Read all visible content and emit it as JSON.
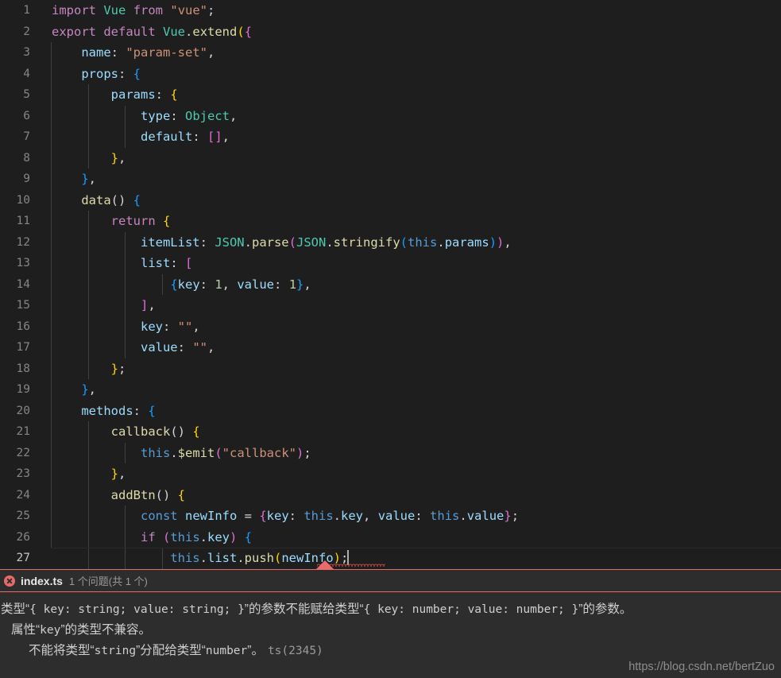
{
  "editor": {
    "language": "typescript",
    "active_line": 27,
    "theme_background": "#1e1e1e",
    "lines": [
      {
        "n": "1",
        "tokens": [
          {
            "t": "import",
            "c": "t-kw"
          },
          {
            "t": " ",
            "c": "t-punct"
          },
          {
            "t": "Vue",
            "c": "t-type"
          },
          {
            "t": " ",
            "c": "t-punct"
          },
          {
            "t": "from",
            "c": "t-kw"
          },
          {
            "t": " ",
            "c": "t-punct"
          },
          {
            "t": "\"vue\"",
            "c": "t-str"
          },
          {
            "t": ";",
            "c": "t-punct"
          }
        ]
      },
      {
        "n": "2",
        "tokens": [
          {
            "t": "export",
            "c": "t-kw"
          },
          {
            "t": " ",
            "c": "t-punct"
          },
          {
            "t": "default",
            "c": "t-kw"
          },
          {
            "t": " ",
            "c": "t-punct"
          },
          {
            "t": "Vue",
            "c": "t-type"
          },
          {
            "t": ".",
            "c": "t-punct"
          },
          {
            "t": "extend",
            "c": "t-fn"
          },
          {
            "t": "(",
            "c": "t-p1"
          },
          {
            "t": "{",
            "c": "t-p2"
          }
        ]
      },
      {
        "n": "3",
        "tokens": [
          {
            "t": "    ",
            "c": "t-punct"
          },
          {
            "t": "name",
            "c": "t-prop"
          },
          {
            "t": ": ",
            "c": "t-punct"
          },
          {
            "t": "\"param-set\"",
            "c": "t-str"
          },
          {
            "t": ",",
            "c": "t-punct"
          }
        ]
      },
      {
        "n": "4",
        "tokens": [
          {
            "t": "    ",
            "c": "t-punct"
          },
          {
            "t": "props",
            "c": "t-prop"
          },
          {
            "t": ": ",
            "c": "t-punct"
          },
          {
            "t": "{",
            "c": "t-p3"
          }
        ]
      },
      {
        "n": "5",
        "tokens": [
          {
            "t": "        ",
            "c": "t-punct"
          },
          {
            "t": "params",
            "c": "t-prop"
          },
          {
            "t": ": ",
            "c": "t-punct"
          },
          {
            "t": "{",
            "c": "t-p1"
          }
        ]
      },
      {
        "n": "6",
        "tokens": [
          {
            "t": "            ",
            "c": "t-punct"
          },
          {
            "t": "type",
            "c": "t-prop"
          },
          {
            "t": ": ",
            "c": "t-punct"
          },
          {
            "t": "Object",
            "c": "t-type"
          },
          {
            "t": ",",
            "c": "t-punct"
          }
        ]
      },
      {
        "n": "7",
        "tokens": [
          {
            "t": "            ",
            "c": "t-punct"
          },
          {
            "t": "default",
            "c": "t-prop"
          },
          {
            "t": ": ",
            "c": "t-punct"
          },
          {
            "t": "[]",
            "c": "t-p2"
          },
          {
            "t": ",",
            "c": "t-punct"
          }
        ]
      },
      {
        "n": "8",
        "tokens": [
          {
            "t": "        ",
            "c": "t-punct"
          },
          {
            "t": "}",
            "c": "t-p1"
          },
          {
            "t": ",",
            "c": "t-punct"
          }
        ]
      },
      {
        "n": "9",
        "tokens": [
          {
            "t": "    ",
            "c": "t-punct"
          },
          {
            "t": "}",
            "c": "t-p3"
          },
          {
            "t": ",",
            "c": "t-punct"
          }
        ]
      },
      {
        "n": "10",
        "tokens": [
          {
            "t": "    ",
            "c": "t-punct"
          },
          {
            "t": "data",
            "c": "t-fn"
          },
          {
            "t": "() ",
            "c": "t-punct"
          },
          {
            "t": "{",
            "c": "t-p3"
          }
        ]
      },
      {
        "n": "11",
        "tokens": [
          {
            "t": "        ",
            "c": "t-punct"
          },
          {
            "t": "return",
            "c": "t-kw"
          },
          {
            "t": " ",
            "c": "t-punct"
          },
          {
            "t": "{",
            "c": "t-p1"
          }
        ]
      },
      {
        "n": "12",
        "tokens": [
          {
            "t": "            ",
            "c": "t-punct"
          },
          {
            "t": "itemList",
            "c": "t-prop"
          },
          {
            "t": ": ",
            "c": "t-punct"
          },
          {
            "t": "JSON",
            "c": "t-type"
          },
          {
            "t": ".",
            "c": "t-punct"
          },
          {
            "t": "parse",
            "c": "t-fn"
          },
          {
            "t": "(",
            "c": "t-p2"
          },
          {
            "t": "JSON",
            "c": "t-type"
          },
          {
            "t": ".",
            "c": "t-punct"
          },
          {
            "t": "stringify",
            "c": "t-fn"
          },
          {
            "t": "(",
            "c": "t-p3"
          },
          {
            "t": "this",
            "c": "t-this"
          },
          {
            "t": ".",
            "c": "t-punct"
          },
          {
            "t": "params",
            "c": "t-prop"
          },
          {
            "t": ")",
            "c": "t-p3"
          },
          {
            "t": ")",
            "c": "t-p2"
          },
          {
            "t": ",",
            "c": "t-punct"
          }
        ]
      },
      {
        "n": "13",
        "tokens": [
          {
            "t": "            ",
            "c": "t-punct"
          },
          {
            "t": "list",
            "c": "t-prop"
          },
          {
            "t": ": ",
            "c": "t-punct"
          },
          {
            "t": "[",
            "c": "t-p2"
          }
        ]
      },
      {
        "n": "14",
        "tokens": [
          {
            "t": "                ",
            "c": "t-punct"
          },
          {
            "t": "{",
            "c": "t-p3"
          },
          {
            "t": "key",
            "c": "t-prop"
          },
          {
            "t": ": ",
            "c": "t-punct"
          },
          {
            "t": "1",
            "c": "t-num"
          },
          {
            "t": ", ",
            "c": "t-punct"
          },
          {
            "t": "value",
            "c": "t-prop"
          },
          {
            "t": ": ",
            "c": "t-punct"
          },
          {
            "t": "1",
            "c": "t-num"
          },
          {
            "t": "}",
            "c": "t-p3"
          },
          {
            "t": ",",
            "c": "t-punct"
          }
        ]
      },
      {
        "n": "15",
        "tokens": [
          {
            "t": "            ",
            "c": "t-punct"
          },
          {
            "t": "]",
            "c": "t-p2"
          },
          {
            "t": ",",
            "c": "t-punct"
          }
        ]
      },
      {
        "n": "16",
        "tokens": [
          {
            "t": "            ",
            "c": "t-punct"
          },
          {
            "t": "key",
            "c": "t-prop"
          },
          {
            "t": ": ",
            "c": "t-punct"
          },
          {
            "t": "\"\"",
            "c": "t-str"
          },
          {
            "t": ",",
            "c": "t-punct"
          }
        ]
      },
      {
        "n": "17",
        "tokens": [
          {
            "t": "            ",
            "c": "t-punct"
          },
          {
            "t": "value",
            "c": "t-prop"
          },
          {
            "t": ": ",
            "c": "t-punct"
          },
          {
            "t": "\"\"",
            "c": "t-str"
          },
          {
            "t": ",",
            "c": "t-punct"
          }
        ]
      },
      {
        "n": "18",
        "tokens": [
          {
            "t": "        ",
            "c": "t-punct"
          },
          {
            "t": "}",
            "c": "t-p1"
          },
          {
            "t": ";",
            "c": "t-punct"
          }
        ]
      },
      {
        "n": "19",
        "tokens": [
          {
            "t": "    ",
            "c": "t-punct"
          },
          {
            "t": "}",
            "c": "t-p3"
          },
          {
            "t": ",",
            "c": "t-punct"
          }
        ]
      },
      {
        "n": "20",
        "tokens": [
          {
            "t": "    ",
            "c": "t-punct"
          },
          {
            "t": "methods",
            "c": "t-prop"
          },
          {
            "t": ": ",
            "c": "t-punct"
          },
          {
            "t": "{",
            "c": "t-p3"
          }
        ]
      },
      {
        "n": "21",
        "tokens": [
          {
            "t": "        ",
            "c": "t-punct"
          },
          {
            "t": "callback",
            "c": "t-fn"
          },
          {
            "t": "() ",
            "c": "t-punct"
          },
          {
            "t": "{",
            "c": "t-p1"
          }
        ]
      },
      {
        "n": "22",
        "tokens": [
          {
            "t": "            ",
            "c": "t-punct"
          },
          {
            "t": "this",
            "c": "t-this"
          },
          {
            "t": ".",
            "c": "t-punct"
          },
          {
            "t": "$emit",
            "c": "t-fn"
          },
          {
            "t": "(",
            "c": "t-p2"
          },
          {
            "t": "\"callback\"",
            "c": "t-str"
          },
          {
            "t": ")",
            "c": "t-p2"
          },
          {
            "t": ";",
            "c": "t-punct"
          }
        ]
      },
      {
        "n": "23",
        "tokens": [
          {
            "t": "        ",
            "c": "t-punct"
          },
          {
            "t": "}",
            "c": "t-p1"
          },
          {
            "t": ",",
            "c": "t-punct"
          }
        ]
      },
      {
        "n": "24",
        "tokens": [
          {
            "t": "        ",
            "c": "t-punct"
          },
          {
            "t": "addBtn",
            "c": "t-fn"
          },
          {
            "t": "() ",
            "c": "t-punct"
          },
          {
            "t": "{",
            "c": "t-p1"
          }
        ]
      },
      {
        "n": "25",
        "tokens": [
          {
            "t": "            ",
            "c": "t-punct"
          },
          {
            "t": "const",
            "c": "t-const"
          },
          {
            "t": " ",
            "c": "t-punct"
          },
          {
            "t": "newInfo",
            "c": "t-var"
          },
          {
            "t": " = ",
            "c": "t-punct"
          },
          {
            "t": "{",
            "c": "t-p2"
          },
          {
            "t": "key",
            "c": "t-prop"
          },
          {
            "t": ": ",
            "c": "t-punct"
          },
          {
            "t": "this",
            "c": "t-this"
          },
          {
            "t": ".",
            "c": "t-punct"
          },
          {
            "t": "key",
            "c": "t-prop"
          },
          {
            "t": ", ",
            "c": "t-punct"
          },
          {
            "t": "value",
            "c": "t-prop"
          },
          {
            "t": ": ",
            "c": "t-punct"
          },
          {
            "t": "this",
            "c": "t-this"
          },
          {
            "t": ".",
            "c": "t-punct"
          },
          {
            "t": "value",
            "c": "t-prop"
          },
          {
            "t": "}",
            "c": "t-p2"
          },
          {
            "t": ";",
            "c": "t-punct"
          }
        ]
      },
      {
        "n": "26",
        "tokens": [
          {
            "t": "            ",
            "c": "t-punct"
          },
          {
            "t": "if",
            "c": "t-kw"
          },
          {
            "t": " ",
            "c": "t-punct"
          },
          {
            "t": "(",
            "c": "t-p2"
          },
          {
            "t": "this",
            "c": "t-this"
          },
          {
            "t": ".",
            "c": "t-punct"
          },
          {
            "t": "key",
            "c": "t-prop"
          },
          {
            "t": ")",
            "c": "t-p2"
          },
          {
            "t": " ",
            "c": "t-punct"
          },
          {
            "t": "{",
            "c": "t-p3"
          }
        ]
      },
      {
        "n": "27",
        "tokens": [
          {
            "t": "                ",
            "c": "t-punct"
          },
          {
            "t": "this",
            "c": "t-this"
          },
          {
            "t": ".",
            "c": "t-punct"
          },
          {
            "t": "list",
            "c": "t-prop"
          },
          {
            "t": ".",
            "c": "t-punct"
          },
          {
            "t": "push",
            "c": "t-fn"
          },
          {
            "t": "(",
            "c": "t-p1"
          },
          {
            "t": "newInfo",
            "c": "t-var"
          },
          {
            "t": ")",
            "c": "t-p1"
          },
          {
            "t": ";",
            "c": "t-punct"
          }
        ]
      }
    ]
  },
  "problem_panel": {
    "error_icon": "error-circle-x-icon",
    "file_name": "index.ts",
    "problem_count": "1 个问题(共 1 个)",
    "accent_color": "#e96a6a",
    "message_lines": [
      {
        "level": 1,
        "parts": [
          {
            "t": "类型“",
            "mono": false
          },
          {
            "t": "{ key: string; value: string; }",
            "mono": true
          },
          {
            "t": "”的参数不能赋给类型“",
            "mono": false
          },
          {
            "t": "{ key: number; value: number; }",
            "mono": true
          },
          {
            "t": "”的参数。",
            "mono": false
          }
        ]
      },
      {
        "level": 2,
        "parts": [
          {
            "t": "属性“",
            "mono": false
          },
          {
            "t": "key",
            "mono": true
          },
          {
            "t": "”的类型不兼容。",
            "mono": false
          }
        ]
      },
      {
        "level": 3,
        "parts": [
          {
            "t": "不能将类型“",
            "mono": false
          },
          {
            "t": "string",
            "mono": true
          },
          {
            "t": "”分配给类型“",
            "mono": false
          },
          {
            "t": "number",
            "mono": true
          },
          {
            "t": "”。",
            "mono": false
          }
        ],
        "ts_code": "ts(2345)"
      }
    ]
  },
  "watermark": {
    "text": "https://blog.csdn.net/bertZuo"
  }
}
